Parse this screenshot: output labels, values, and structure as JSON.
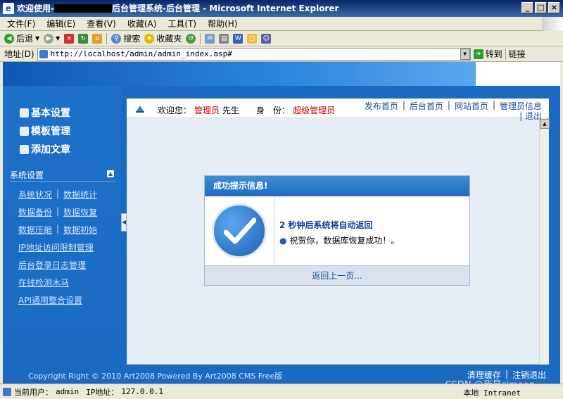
{
  "window": {
    "title_prefix": "欢迎使用-",
    "title_suffix": "后台管理系统-后台管理 - Microsoft Internet Explorer",
    "min": "_",
    "max": "□",
    "close": "×"
  },
  "menu": [
    "文件(F)",
    "编辑(E)",
    "查看(V)",
    "收藏(A)",
    "工具(T)",
    "帮助(H)"
  ],
  "toolbar": {
    "back": "后退",
    "search": "搜索",
    "favorites": "收藏夹"
  },
  "address": {
    "label": "地址(D)",
    "url": "http://localhost/admin/admin_index.asp#",
    "go": "转到",
    "links": "链接"
  },
  "sidebar": {
    "nav": [
      "基本设置",
      "模板管理",
      "添加文章"
    ],
    "section_title": "系统设置",
    "pairs": [
      [
        "系统状况",
        "数据统计"
      ],
      [
        "数据备份",
        "数据恢复"
      ],
      [
        "数据压缩",
        "数据初始"
      ]
    ],
    "links": [
      "IP地址访问限制管理",
      "后台登录日志管理",
      "在线检测木马",
      "API通用整合设置"
    ],
    "separator": "|"
  },
  "userbar": {
    "welcome": "欢迎您：",
    "user": "管理员",
    "mr": "先生",
    "role_label": "身　份：",
    "role": "超级管理员",
    "links": [
      "发布首页",
      "后台首页",
      "网站首页",
      "管理员信息"
    ],
    "logout": "退出",
    "separator": "|"
  },
  "dialog": {
    "title": "成功提示信息!",
    "heading": "2 秒钟后系统将自动返回",
    "bullet": "●",
    "message": "祝贺你，数据库恢复成功！。",
    "back": "返回上一页..."
  },
  "footer": {
    "copyright": "Copyright Right © 2010 Art2008 Powered By Art2008 CMS Free版",
    "links": [
      "清理缓存",
      "注销退出"
    ],
    "separator": "|"
  },
  "status": {
    "user_label": "当前用户：",
    "user": "admin",
    "ip_label": "IP地址：",
    "ip": "127.0.0.1",
    "zone": "本地 Intranet",
    "watermark": "CSDN @我是simeon"
  },
  "colors": {
    "accent": "#1a6ac2",
    "role": "#cc0000",
    "dialog_header": "#1f6cc0"
  }
}
